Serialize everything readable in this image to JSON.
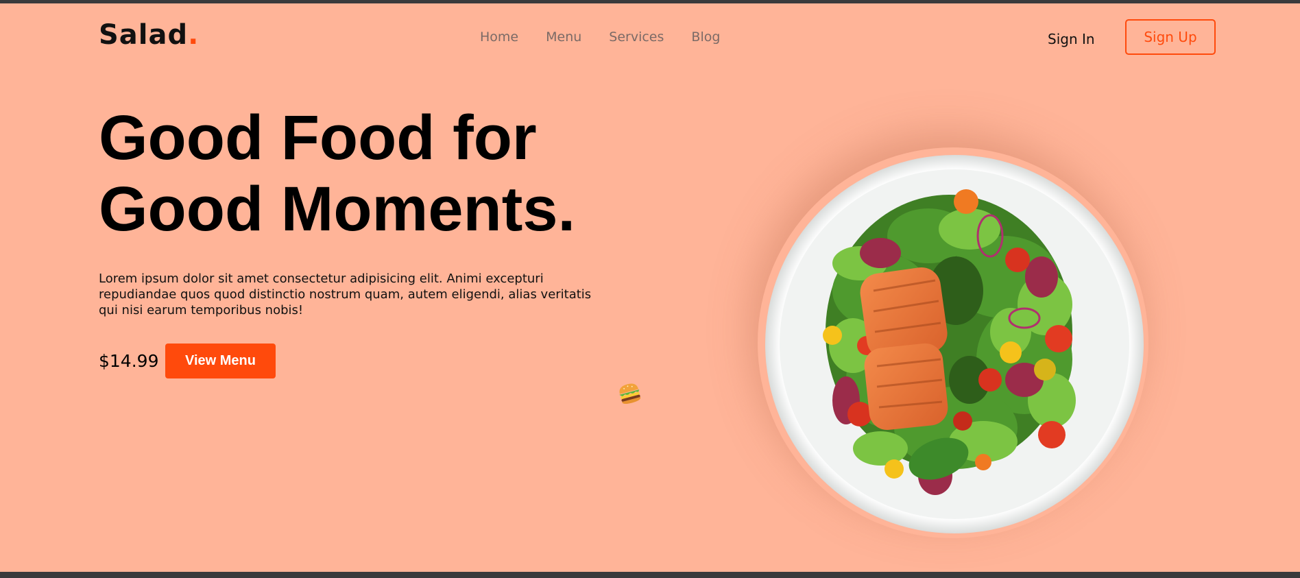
{
  "header": {
    "logo_text": "Salad",
    "logo_dot": ".",
    "nav": [
      "Home",
      "Menu",
      "Services",
      "Blog"
    ],
    "sign_in_label": "Sign In",
    "sign_up_label": "Sign Up"
  },
  "hero": {
    "title_line1": "Good Food for",
    "title_line2": "Good Moments.",
    "description": "Lorem ipsum dolor sit amet consectetur adipisicing elit. Animi excepturi repudiandae quos quod distinctio nostrum quam, autem eligendi, alias veritatis qui nisi earum temporibus nobis!",
    "price": "$14.99",
    "cta_label": "View Menu"
  },
  "images": {
    "hero_image": "salmon-salad-plate",
    "floating_icon": "burger-icon"
  },
  "colors": {
    "background": "#ffb498",
    "accent": "#ff4a0c",
    "text": "#111111",
    "nav_text": "#7a6a66"
  }
}
